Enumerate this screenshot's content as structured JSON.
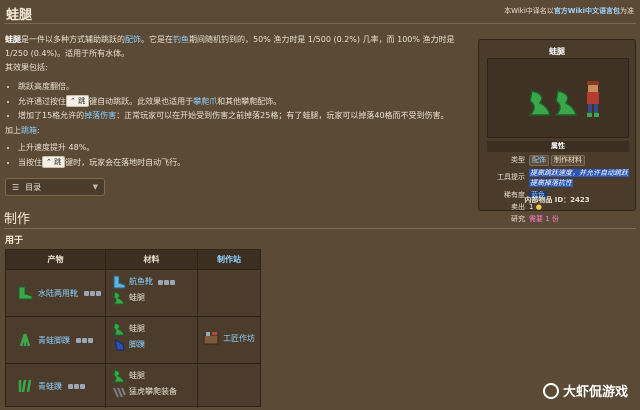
{
  "page": {
    "title": "蛙腿",
    "top_note": "本Wiki中译名以",
    "top_note_link": "官方Wiki中文语言包",
    "top_note_tail": "为准"
  },
  "intro": {
    "p1_bold": "蛙腿",
    "p1_a": "是一件以多种方式辅助跳跃的",
    "p1_link": "配饰",
    "p1_b": "。它是在",
    "p1_link2": "钓鱼",
    "p1_c": "期间随机钓到的，50% 渔力时是 1/500 (0.2%) 几率，而 100% 渔力时是 1/250 (0.4%)。适用于所有水体。",
    "effects_label": "其效果包括:",
    "e1": "跳跃高度翻倍。",
    "e2_a": "允许通过按住",
    "e2_key": "⌃ 跳",
    "e2_b": "键自动跳跃。此效果也适用于",
    "e2_link": "攀爬爪",
    "e2_c": "和其他攀爬配饰。",
    "e3_a": "增加了15格允许的",
    "e3_link": "掉落伤害",
    "e3_b": "：正常玩家可以在开始受到伤害之前掉落25格；有了蛙腿，玩家可以掉落40格而不受到伤害。",
    "plus_a": "加上",
    "plus_link": "跳箱",
    "plus_b": ":",
    "p1": "上升速度提升 48%。",
    "p2_a": "当按住",
    "p2_key": "⌃ 跳",
    "p2_b": "键时，玩家会在落地时自动飞行。"
  },
  "toc": {
    "label": "目录"
  },
  "crafting": {
    "heading": "制作",
    "subheading": "用于",
    "headers": [
      "产物",
      "材料",
      "制作站"
    ],
    "station": "工匠作坊",
    "rows": [
      {
        "product": "水陆两用靴",
        "materials": [
          "航鱼靴",
          "蛙腿"
        ]
      },
      {
        "product": "青蛙脚蹼",
        "materials": [
          "蛙腿",
          "脚蹼"
        ]
      },
      {
        "product": "青蛙蹼",
        "materials": [
          "蛙腿",
          "猛虎攀爬装备"
        ]
      }
    ]
  },
  "infobox": {
    "title": "蛙腿",
    "properties_header": "属性",
    "type_label": "类型",
    "type_tags": [
      "配饰",
      "制作材料"
    ],
    "tooltip_label": "工具提示",
    "tooltip_1": "提高跳跃速度，并允许自动跳跃",
    "tooltip_2": "提高掉落抗性",
    "rarity_label": "稀有度",
    "rarity_value": "蓝色",
    "sell_label": "卖出",
    "sell_value": "1",
    "research_label": "研究",
    "research_value": "需要 1 份",
    "internal_id": "内部物品 ID：2423"
  },
  "watermark": {
    "text": "大虾侃游戏"
  },
  "colors": {
    "background": "#5b4a35",
    "link": "#8fd0ff",
    "tooltip_bg": "#2a56b8",
    "frog_green": "#3aa84a"
  }
}
